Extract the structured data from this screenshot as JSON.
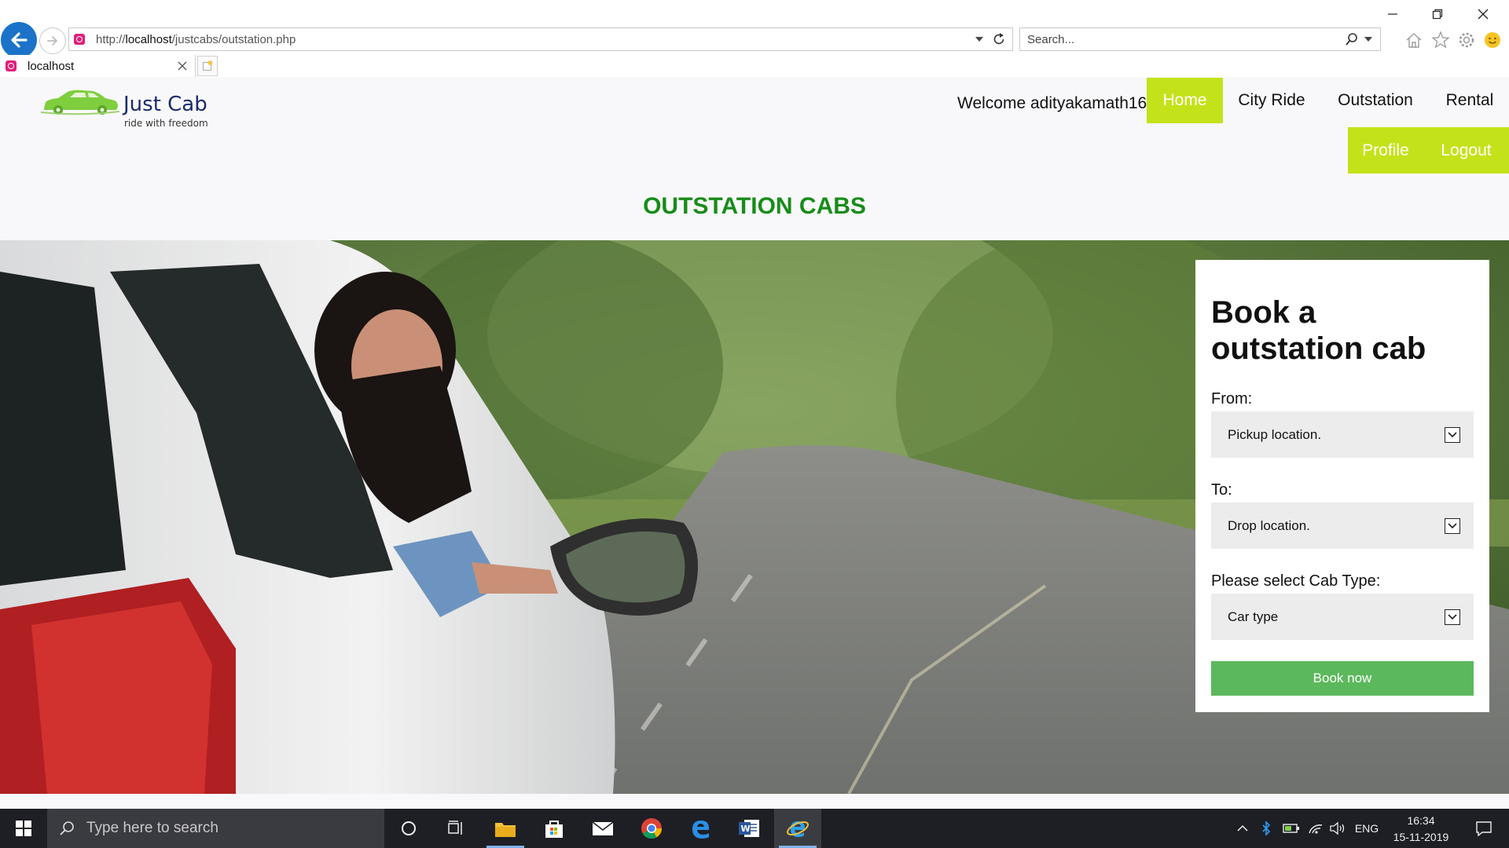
{
  "browser": {
    "url_prefix": "http://",
    "url_host": "localhost",
    "url_path": "/justcabs/outstation.php",
    "search_placeholder": "Search...",
    "tab_title": "localhost"
  },
  "site": {
    "logo_name": "Just Cab",
    "logo_tagline": "ride with freedom",
    "welcome_text": "Welcome adityakamath16 .",
    "nav": {
      "home": "Home",
      "city_ride": "City Ride",
      "outstation": "Outstation",
      "rental": "Rental",
      "profile": "Profile",
      "logout": "Logout"
    },
    "page_title": "OUTSTATION CABS",
    "accent_color": "#c4e21a",
    "title_color": "#188c18"
  },
  "booking": {
    "title": "Book a outstation cab",
    "from_label": "From:",
    "from_value": "Pickup location.",
    "to_label": "To:",
    "to_value": "Drop location.",
    "cab_type_label": "Please select Cab Type:",
    "cab_type_value": "Car type",
    "submit_label": "Book now",
    "submit_color": "#5cb85c"
  },
  "taskbar": {
    "search_placeholder": "Type here to search",
    "language": "ENG",
    "time": "16:34",
    "date": "15-11-2019",
    "apps": [
      "task-view",
      "file-explorer",
      "microsoft-store",
      "mail",
      "chrome",
      "edge",
      "word",
      "internet-explorer"
    ]
  }
}
